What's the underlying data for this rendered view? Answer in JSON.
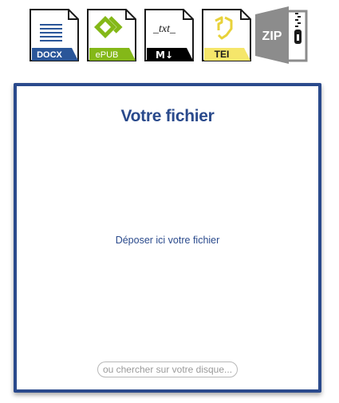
{
  "formats": {
    "docx": {
      "label": "DOCX",
      "icon": "docx-file-icon",
      "color": "#2a5699"
    },
    "epub": {
      "label": "ePUB",
      "icon": "epub-file-icon",
      "color": "#84b818"
    },
    "markdown": {
      "label": "_txt_",
      "badge": "M↓",
      "icon": "markdown-file-icon",
      "color": "#000000"
    },
    "tei": {
      "label": "TEI",
      "icon": "tei-file-icon",
      "color": "#f5e66a"
    },
    "zip": {
      "label": "ZIP",
      "icon": "zip-file-icon",
      "color": "#8c8c8c"
    }
  },
  "dropzone": {
    "title": "Votre fichier",
    "hint": "Déposer ici votre fichier",
    "browse_label": "ou chercher sur votre disque..."
  },
  "colors": {
    "accent": "#2a4a8c"
  }
}
